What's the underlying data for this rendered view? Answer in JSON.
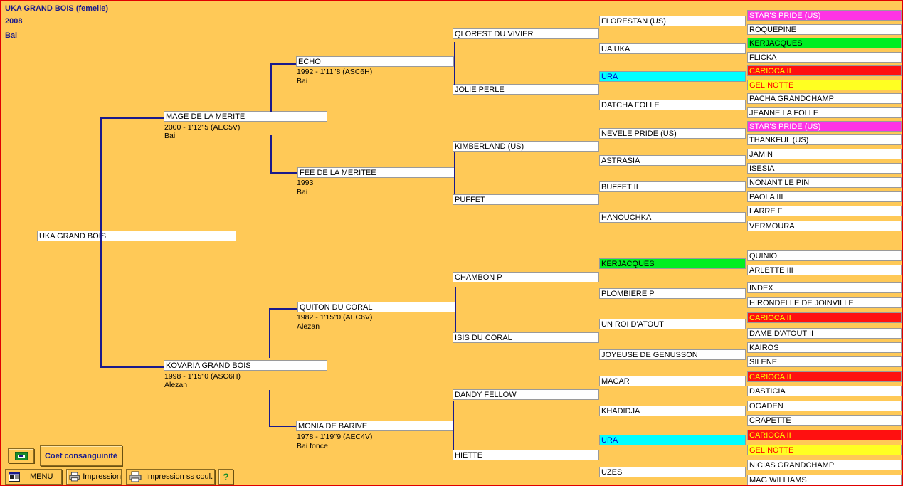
{
  "header": {
    "name": "UKA GRAND BOIS  (femelle)",
    "year": "2008",
    "coat": "Bai"
  },
  "colors": {
    "background": "#FFC957",
    "lines": "#1a1a8c",
    "magenta": "#FF33E5",
    "green": "#00EE22",
    "red": "#FF1010",
    "yellow": "#FFFF22",
    "cyan": "#00FFFF"
  },
  "pedigree": {
    "subject": "UKA GRAND BOIS",
    "sire": {
      "name": "MAGE DE LA MERITE",
      "perf": "2000 -  1'12''5 (AEC5V)",
      "coat": "Bai"
    },
    "dam": {
      "name": "KOVARIA GRAND BOIS",
      "perf": "1998 -  1'15''0 (ASC6H)",
      "coat": "Alezan"
    },
    "g2": [
      {
        "name": "ECHO",
        "perf": "1992 -  1'11''8 (ASC6H)",
        "coat": "Bai"
      },
      {
        "name": "FEE DE LA MERITEE",
        "perf": "1993",
        "coat": "Bai"
      },
      {
        "name": "QUITON DU CORAL",
        "perf": "1982 -  1'15''0 (AEC6V)",
        "coat": "Alezan"
      },
      {
        "name": "MONIA DE BARIVE",
        "perf": "1978 -  1'19''9 (AEC4V)",
        "coat": "Bai fonce"
      }
    ],
    "g3": [
      "QLOREST DU VIVIER",
      "JOLIE PERLE",
      "KIMBERLAND (US)",
      "PUFFET",
      "CHAMBON P",
      "ISIS DU CORAL",
      "DANDY FELLOW",
      "HIETTE"
    ],
    "g4": [
      {
        "name": "FLORESTAN (US)",
        "hl": ""
      },
      {
        "name": "UA UKA",
        "hl": ""
      },
      {
        "name": "URA",
        "hl": "cyan"
      },
      {
        "name": "DATCHA FOLLE",
        "hl": ""
      },
      {
        "name": "NEVELE PRIDE (US)",
        "hl": ""
      },
      {
        "name": "ASTRASIA",
        "hl": ""
      },
      {
        "name": "BUFFET II",
        "hl": ""
      },
      {
        "name": "HANOUCHKA",
        "hl": ""
      },
      {
        "name": "KERJACQUES",
        "hl": "green"
      },
      {
        "name": "PLOMBIERE P",
        "hl": ""
      },
      {
        "name": "UN ROI D'ATOUT",
        "hl": ""
      },
      {
        "name": "JOYEUSE DE GENUSSON",
        "hl": ""
      },
      {
        "name": "MACAR",
        "hl": ""
      },
      {
        "name": "KHADIDJA",
        "hl": ""
      },
      {
        "name": "URA",
        "hl": "cyan"
      },
      {
        "name": "UZES",
        "hl": ""
      }
    ],
    "g5": [
      {
        "name": "STAR'S PRIDE (US)",
        "hl": "magenta"
      },
      {
        "name": "ROQUEPINE",
        "hl": ""
      },
      {
        "name": "KERJACQUES",
        "hl": "green"
      },
      {
        "name": "FLICKA",
        "hl": ""
      },
      {
        "name": "CARIOCA II",
        "hl": "red"
      },
      {
        "name": "GELINOTTE",
        "hl": "yellow"
      },
      {
        "name": "PACHA GRANDCHAMP",
        "hl": ""
      },
      {
        "name": "JEANNE LA FOLLE",
        "hl": ""
      },
      {
        "name": "STAR'S PRIDE (US)",
        "hl": "magenta"
      },
      {
        "name": "THANKFUL (US)",
        "hl": ""
      },
      {
        "name": "JAMIN",
        "hl": ""
      },
      {
        "name": "ISESIA",
        "hl": ""
      },
      {
        "name": "NONANT LE PIN",
        "hl": ""
      },
      {
        "name": "PAOLA III",
        "hl": ""
      },
      {
        "name": "LARRE F",
        "hl": ""
      },
      {
        "name": "VERMOURA",
        "hl": ""
      },
      {
        "name": "QUINIO",
        "hl": ""
      },
      {
        "name": "ARLETTE III",
        "hl": ""
      },
      {
        "name": "INDEX",
        "hl": ""
      },
      {
        "name": "HIRONDELLE DE JOINVILLE",
        "hl": ""
      },
      {
        "name": "CARIOCA II",
        "hl": "red"
      },
      {
        "name": "DAME D'ATOUT II",
        "hl": ""
      },
      {
        "name": "KAIROS",
        "hl": ""
      },
      {
        "name": "SILENE",
        "hl": ""
      },
      {
        "name": "CARIOCA II",
        "hl": "red"
      },
      {
        "name": "DASTICIA",
        "hl": ""
      },
      {
        "name": "OGADEN",
        "hl": ""
      },
      {
        "name": "CRAPETTE",
        "hl": ""
      },
      {
        "name": "CARIOCA II",
        "hl": "red"
      },
      {
        "name": "GELINOTTE",
        "hl": "yellow"
      },
      {
        "name": "NICIAS GRANDCHAMP",
        "hl": ""
      },
      {
        "name": "MAG WILLIAMS",
        "hl": ""
      }
    ]
  },
  "toolbar": {
    "coef_label": "Coef consanguinité",
    "menu_label": "MENU",
    "print_label": "Impression",
    "print_nocolor_label": "Impression ss coul.",
    "help_label": "?",
    "flag_icon": "flag-icon",
    "menu_icon": "menu-icon",
    "printer_icon": "printer-icon"
  }
}
